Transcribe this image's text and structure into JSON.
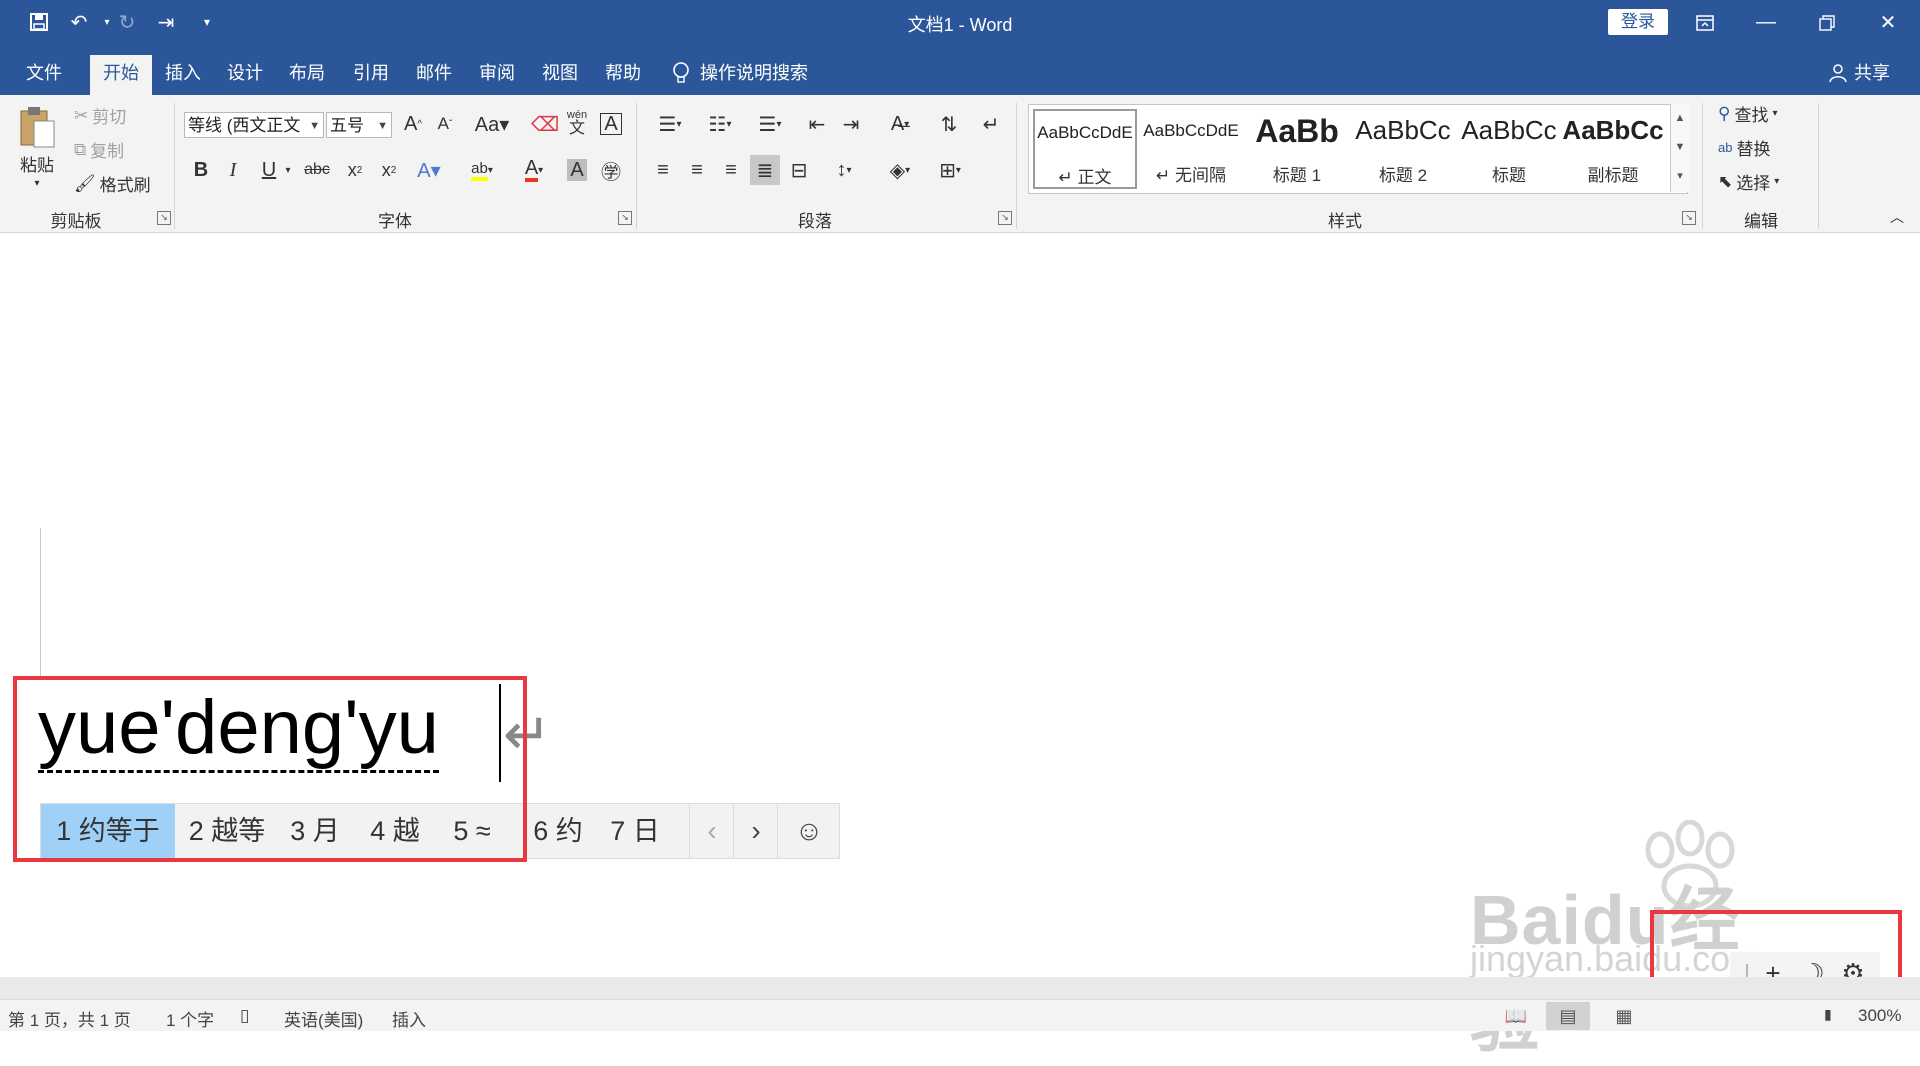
{
  "window": {
    "title": "文档1  -  Word",
    "login_label": "登录"
  },
  "tabs": [
    "文件",
    "开始",
    "插入",
    "设计",
    "布局",
    "引用",
    "邮件",
    "审阅",
    "视图",
    "帮助"
  ],
  "tell_me": "操作说明搜索",
  "share": "共享",
  "clipboard": {
    "paste": "粘贴",
    "cut": "剪切",
    "copy": "复制",
    "format_painter": "格式刷",
    "group": "剪贴板"
  },
  "font": {
    "name": "等线 (西文正文",
    "size": "五号",
    "group": "字体",
    "phonetic_top": "wén",
    "phonetic_bottom": "文"
  },
  "paragraph": {
    "group": "段落"
  },
  "styles": {
    "group": "样式",
    "items": [
      {
        "preview": "AaBbCcDdE",
        "name": "↵ 正文"
      },
      {
        "preview": "AaBbCcDdE",
        "name": "↵ 无间隔"
      },
      {
        "preview": "AaBb",
        "name": "标题 1"
      },
      {
        "preview": "AaBbCc",
        "name": "标题 2"
      },
      {
        "preview": "AaBbCc",
        "name": "标题"
      },
      {
        "preview": "AaBbCc",
        "name": "副标题"
      }
    ]
  },
  "editing": {
    "find": "查找",
    "replace": "替换",
    "select": "选择",
    "group": "编辑"
  },
  "document": {
    "typed_text": "yue'deng'yu"
  },
  "ime": {
    "candidates": [
      {
        "num": "1",
        "text": "约等于"
      },
      {
        "num": "2",
        "text": "越等"
      },
      {
        "num": "3",
        "text": "月"
      },
      {
        "num": "4",
        "text": "越"
      },
      {
        "num": "5",
        "text": "≈"
      },
      {
        "num": "6",
        "text": "约"
      },
      {
        "num": "7",
        "text": "日"
      }
    ]
  },
  "watermark": {
    "brand": "Baidu经验",
    "url": "jingyan.baidu.com"
  },
  "status": {
    "page": "第 1 页，共 1 页",
    "words": "1 个字",
    "language": "英语(美国)",
    "mode": "插入",
    "zoom": "300%"
  }
}
